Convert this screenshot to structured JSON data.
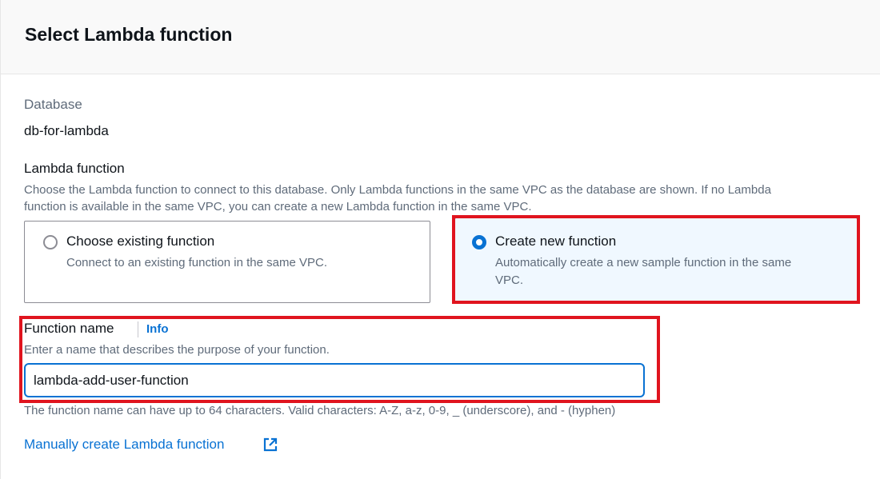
{
  "header": {
    "title": "Select Lambda function"
  },
  "database": {
    "label": "Database",
    "value": "db-for-lambda"
  },
  "lambda_function": {
    "label": "Lambda function",
    "description_line1": "Choose the Lambda function to connect to this database. Only Lambda functions in the same VPC as the database are shown. If no Lambda",
    "description_line2": "function is available in the same VPC, you can create a new Lambda function in the same VPC.",
    "options": [
      {
        "title": "Choose existing function",
        "description": "Connect to an existing function in the same VPC.",
        "selected": false
      },
      {
        "title": "Create new function",
        "description_line1": "Automatically create a new sample function in the same",
        "description_line2": "VPC.",
        "selected": true
      }
    ]
  },
  "function_name": {
    "label": "Function name",
    "info_label": "Info",
    "description": "Enter a name that describes the purpose of your function.",
    "value": "lambda-add-user-function",
    "constraint": "The function name can have up to 64 characters. Valid characters: A-Z, a-z, 0-9, _ (underscore), and - (hyphen)"
  },
  "manual_link": {
    "label": "Manually create Lambda function",
    "icon": "external-link-icon"
  },
  "colors": {
    "accent": "#0972d3",
    "highlight": "#e0141e",
    "muted": "#5f6b7a"
  }
}
